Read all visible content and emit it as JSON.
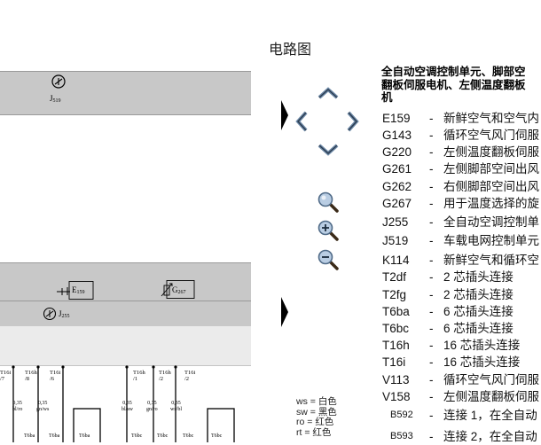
{
  "header": {
    "title": "电路图"
  },
  "diagram": {
    "top_component": {
      "name": "J",
      "sub": "519"
    },
    "middle_components": [
      {
        "name": "E",
        "sub": "159"
      },
      {
        "name": "G",
        "sub": "267"
      },
      {
        "name": "J",
        "sub": "255"
      }
    ],
    "pin_labels": [
      {
        "conn": "T16i",
        "pin": "/7"
      },
      {
        "conn": "T16h",
        "pin": "/8"
      },
      {
        "conn": "T16i",
        "pin": "/6"
      },
      {
        "conn": "T16h",
        "pin": "/1"
      },
      {
        "conn": "T16h",
        "pin": "/2"
      },
      {
        "conn": "T16i",
        "pin": "/2"
      }
    ],
    "wire_labels": [
      {
        "size": "0,35",
        "color": "bl/ro"
      },
      {
        "size": "0,35",
        "color": "gn/ws"
      },
      {
        "size": "0,35",
        "color": "bl/sw"
      },
      {
        "size": "0,35",
        "color": "gn/ro"
      },
      {
        "size": "0,35",
        "color": "ws/bl"
      }
    ],
    "connector_labels": [
      "T6ba",
      "T6ba",
      "T6ba",
      "T6bc",
      "T6bc",
      "T6bc",
      "T6bc"
    ]
  },
  "nav": {
    "up": "arrow-up-icon",
    "left": "arrow-left-icon",
    "right": "arrow-right-icon",
    "down": "arrow-down-icon",
    "zoom_fit": "magnifier-icon",
    "zoom_in": "zoom-in-icon",
    "zoom_out": "zoom-out-icon"
  },
  "color_legend": [
    {
      "code": "ws",
      "label": "白色"
    },
    {
      "code": "sw",
      "label": "黑色"
    },
    {
      "code": "ro",
      "label": "红色"
    },
    {
      "code": "rt",
      "label": "红色"
    }
  ],
  "legend": {
    "title": "全自动空调控制单元、脚部空\n翻板伺服电机、左侧温度翻板\n机",
    "items": [
      {
        "code": "E159",
        "desc": "新鲜空气和空气内"
      },
      {
        "code": "G143",
        "desc": "循环空气风门伺服"
      },
      {
        "code": "G220",
        "desc": "左侧温度翻板伺服"
      },
      {
        "code": "G261",
        "desc": "左侧脚部空间出风"
      },
      {
        "code": "G262",
        "desc": "右侧脚部空间出风"
      },
      {
        "code": "G267",
        "desc": "用于温度选择的旋"
      },
      {
        "code": "J255",
        "desc": "全自动空调控制单"
      },
      {
        "code": "J519",
        "desc": "车载电网控制单元"
      },
      {
        "code": "K114",
        "desc": "新鲜空气和循环空"
      },
      {
        "code": "T2df",
        "desc": "2 芯插头连接"
      },
      {
        "code": "T2fg",
        "desc": "2 芯插头连接"
      },
      {
        "code": "T6ba",
        "desc": "6 芯插头连接"
      },
      {
        "code": "T6bc",
        "desc": "6 芯插头连接"
      },
      {
        "code": "T16h",
        "desc": "16 芯插头连接"
      },
      {
        "code": "T16i",
        "desc": "16 芯插头连接"
      },
      {
        "code": "V113",
        "desc": "循环空气风门伺服"
      },
      {
        "code": "V158",
        "desc": "左侧温度翻板伺服"
      },
      {
        "code": "B592",
        "desc": "连接 1，在全自动"
      },
      {
        "code": "B593",
        "desc": "连接 2，在全自动"
      }
    ]
  }
}
